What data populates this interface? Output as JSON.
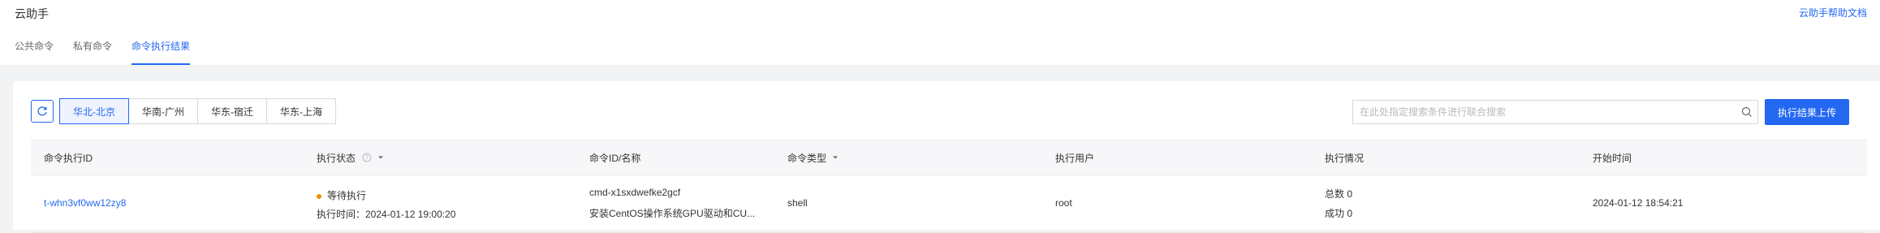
{
  "app": {
    "title": "云助手",
    "help_link": "云助手帮助文档"
  },
  "tabs": [
    {
      "label": "公共命令",
      "active": false
    },
    {
      "label": "私有命令",
      "active": false
    },
    {
      "label": "命令执行结果",
      "active": true
    }
  ],
  "toolbar": {
    "refresh_icon": "refresh-icon",
    "regions": [
      {
        "label": "华北-北京",
        "active": true
      },
      {
        "label": "华南-广州",
        "active": false
      },
      {
        "label": "华东-宿迁",
        "active": false
      },
      {
        "label": "华东-上海",
        "active": false
      }
    ],
    "search_placeholder": "在此处指定搜索条件进行联合搜索",
    "upload_button": "执行结果上传"
  },
  "colors": {
    "accent": "#2468f2",
    "pending": "#f39000"
  },
  "table": {
    "columns": [
      "命令执行ID",
      "执行状态",
      "命令ID/名称",
      "命令类型",
      "执行用户",
      "执行情况",
      "开始时间"
    ],
    "rows": [
      {
        "exec_id": "t-whn3vf0ww12zy8",
        "status": "等待执行",
        "exec_time": "执行时间：2024-01-12 19:00:20",
        "cmd_id": "cmd-x1sxdwefke2gcf",
        "cmd_name": "安装CentOS操作系统GPU驱动和CU...",
        "cmd_type": "shell",
        "user": "root",
        "total": "总数 0",
        "success": "成功 0",
        "start_time": "2024-01-12 18:54:21"
      }
    ]
  }
}
